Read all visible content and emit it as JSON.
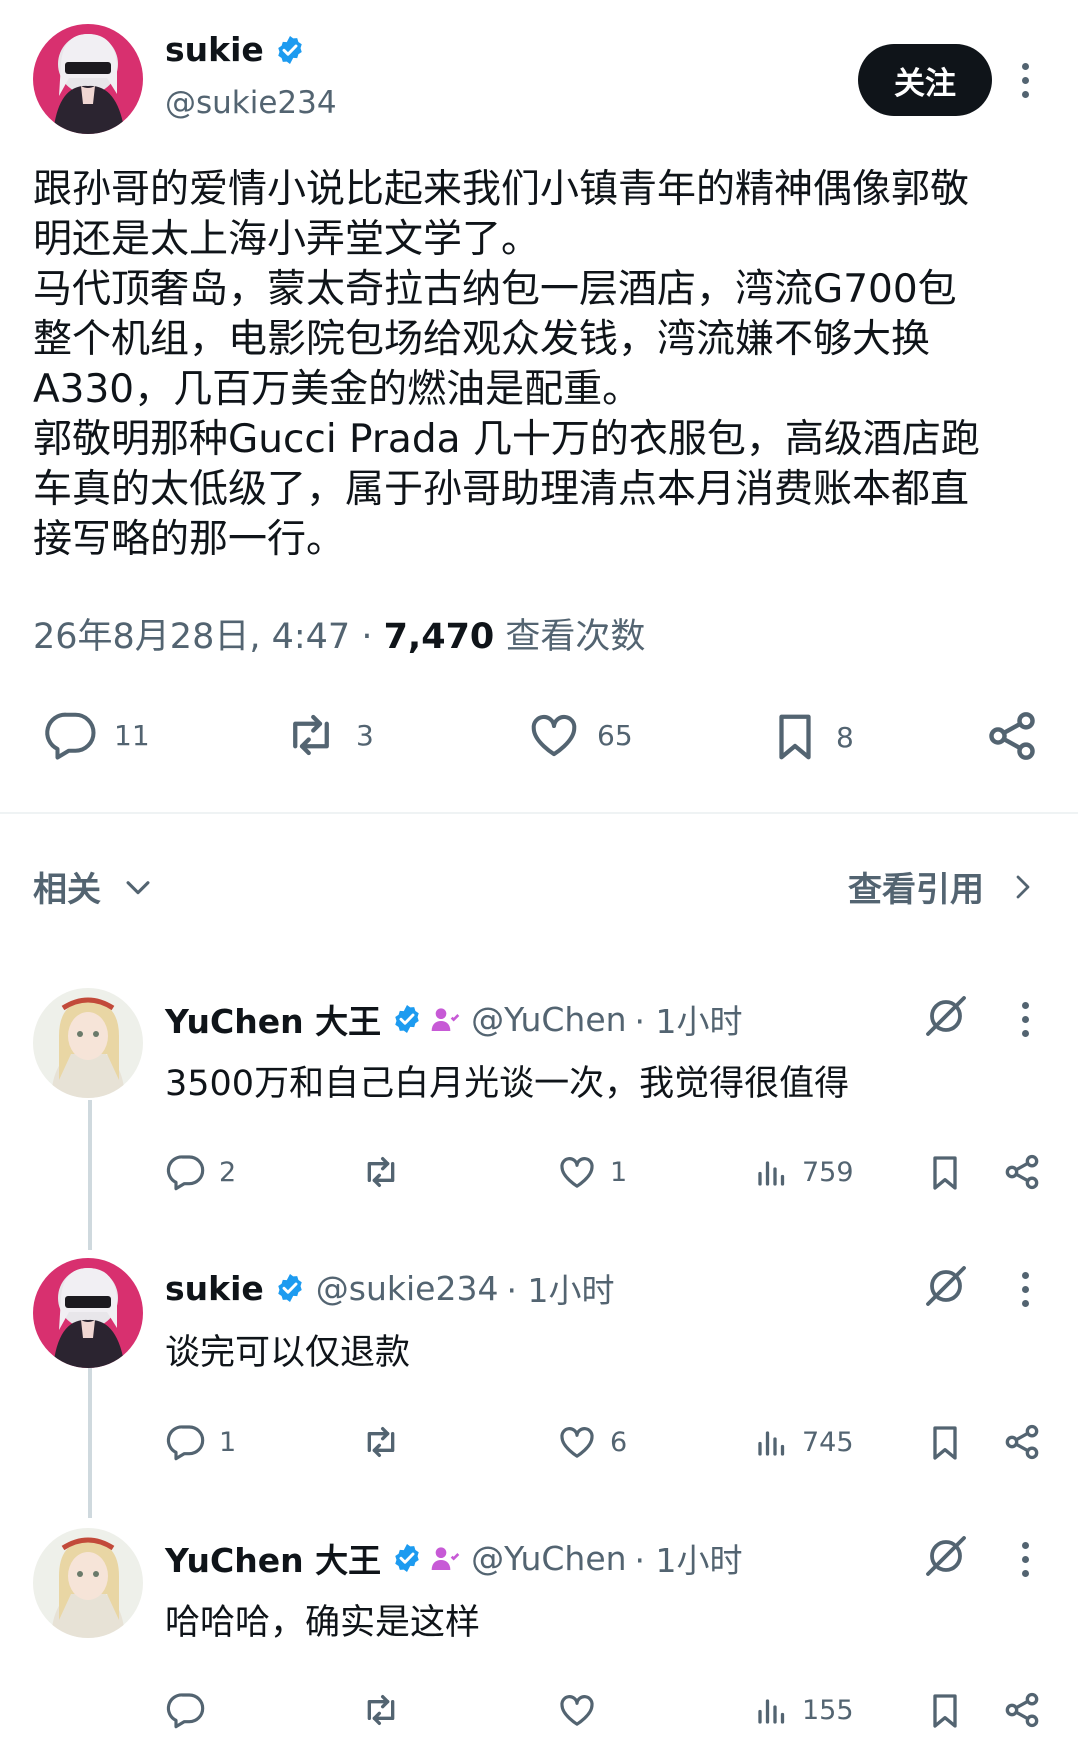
{
  "post": {
    "author": {
      "name": "sukie",
      "handle": "@sukie234",
      "verified": true
    },
    "follow_label": "关注",
    "body_lines": [
      "跟孙哥的爱情小说比起来我们小镇青年的精神偶像郭敬",
      "明还是太上海小弄堂文学了。",
      "马代顶奢岛，蒙太奇拉古纳包一层酒店，湾流G700包",
      "整个机组，电影院包场给观众发钱，湾流嫌不够大换",
      "A330，几百万美金的燃油是配重。",
      "郭敬明那种Gucci Prada 几十万的衣服包，高级酒店跑",
      "车真的太低级了，属于孙哥助理清点本月消费账本都直",
      "接写略的那一行。"
    ],
    "meta": {
      "datetime": "26年8月28日, 4:47 · ",
      "views": "7,470",
      "views_label": " 查看次数"
    },
    "actions": {
      "replies": "11",
      "reposts": "3",
      "likes": "65",
      "bookmarks": "8"
    }
  },
  "related_label": "相关",
  "view_quotes_label": "查看引用",
  "replies": [
    {
      "name": "YuChen 大王",
      "handle": "@YuChen",
      "time": "· 1小时",
      "affiliate": true,
      "text": "3500万和自己白月光谈一次，我觉得很值得",
      "replies": "2",
      "reposts": "",
      "likes": "1",
      "views": "759"
    },
    {
      "name": "sukie",
      "handle": "@sukie234",
      "time": "· 1小时",
      "affiliate": false,
      "text": "谈完可以仅退款",
      "replies": "1",
      "reposts": "",
      "likes": "6",
      "views": "745"
    },
    {
      "name": "YuChen 大王",
      "handle": "@YuChen",
      "time": "· 1小时",
      "affiliate": true,
      "text": "哈哈哈，确实是这样",
      "replies": "",
      "reposts": "",
      "likes": "",
      "views": "155"
    }
  ],
  "colors": {
    "verified": "#1d9bf0",
    "affiliate": "#c75ad6",
    "muted": "#536471",
    "text": "#0f1419"
  },
  "icons": [
    "reply-icon",
    "repost-icon",
    "like-icon",
    "bookmark-icon",
    "share-icon",
    "views-icon",
    "grok-icon",
    "more-icon",
    "verified-badge-icon",
    "chevron-down-icon",
    "chevron-right-icon"
  ]
}
